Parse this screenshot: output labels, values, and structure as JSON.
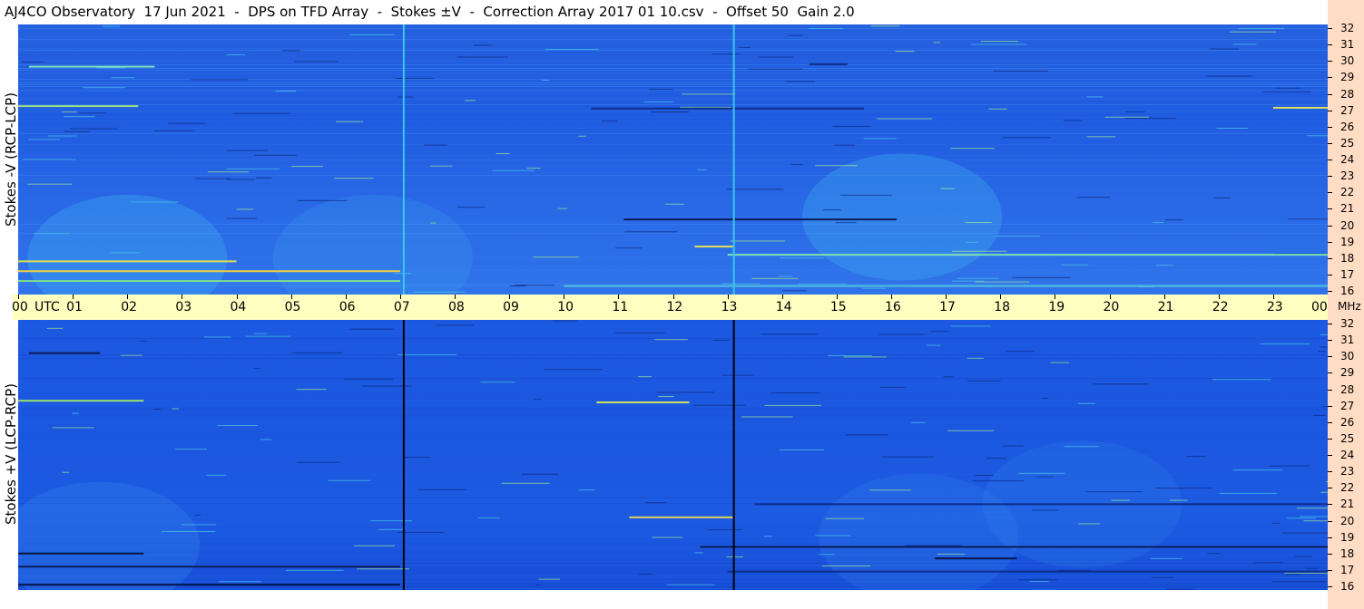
{
  "title": "AJ4CO Observatory  17 Jun 2021  -  DPS on TFD Array  -  Stokes ±V  -  Correction Array 2017 01 10.csv  -  Offset 50  Gain 2.0",
  "colors": {
    "time_axis_bg": "#ffffc0",
    "freq_axis_bg": "#ffdcc4",
    "background_blue": "#1f5be0"
  },
  "chart_data": [
    {
      "type": "heatmap",
      "name": "top-panel",
      "ylabel": "Stokes -V (RCP-LCP)",
      "x_ticks": [
        "00",
        "01",
        "02",
        "03",
        "04",
        "05",
        "06",
        "07",
        "08",
        "09",
        "10",
        "11",
        "12",
        "13",
        "14",
        "15",
        "16",
        "17",
        "18",
        "19",
        "20",
        "21",
        "22",
        "23",
        "00"
      ],
      "x_unit": "UTC",
      "xlim": [
        0,
        24
      ],
      "y_ticks": [
        "32",
        "31",
        "30",
        "29",
        "28",
        "27",
        "26",
        "25",
        "24",
        "23",
        "22",
        "21",
        "20",
        "19",
        "18",
        "17",
        "16"
      ],
      "y_unit": "MHz",
      "ylim": [
        16,
        32
      ],
      "vertical_lines_utc": [
        7.05,
        13.1
      ],
      "vertical_line_color": "#38c8e8",
      "bands": [
        {
          "mhz": 29.65,
          "t0": 0.2,
          "t1": 2.5,
          "color": "#7fe0c0"
        },
        {
          "mhz": 27.25,
          "t0": 0.0,
          "t1": 2.2,
          "color": "#9ae080"
        },
        {
          "mhz": 27.1,
          "t0": 10.5,
          "t1": 15.5,
          "color": "#0d2d8a"
        },
        {
          "mhz": 27.15,
          "t0": 23.0,
          "t1": 24.0,
          "color": "#e0e060"
        },
        {
          "mhz": 20.35,
          "t0": 11.1,
          "t1": 16.1,
          "color": "#0a1c5a"
        },
        {
          "mhz": 18.7,
          "t0": 12.4,
          "t1": 13.1,
          "color": "#e0e060"
        },
        {
          "mhz": 18.2,
          "t0": 13.0,
          "t1": 24.0,
          "color": "#7fe0b0"
        },
        {
          "mhz": 17.8,
          "t0": 0.0,
          "t1": 4.0,
          "color": "#e0e050"
        },
        {
          "mhz": 17.2,
          "t0": 0.0,
          "t1": 7.0,
          "color": "#f0d040"
        },
        {
          "mhz": 16.6,
          "t0": 0.0,
          "t1": 7.0,
          "color": "#80e090"
        },
        {
          "mhz": 16.3,
          "t0": 10.0,
          "t1": 24.0,
          "color": "#50c0e0"
        },
        {
          "mhz": 29.8,
          "t0": 14.5,
          "t1": 15.2,
          "color": "#0d2d8a"
        }
      ]
    },
    {
      "type": "heatmap",
      "name": "bottom-panel",
      "ylabel": "Stokes +V (LCP-RCP)",
      "x_ticks": [
        "00",
        "01",
        "02",
        "03",
        "04",
        "05",
        "06",
        "07",
        "08",
        "09",
        "10",
        "11",
        "12",
        "13",
        "14",
        "15",
        "16",
        "17",
        "18",
        "19",
        "20",
        "21",
        "22",
        "23",
        "00"
      ],
      "x_unit": "UTC",
      "xlim": [
        0,
        24
      ],
      "y_ticks": [
        "32",
        "31",
        "30",
        "29",
        "28",
        "27",
        "26",
        "25",
        "24",
        "23",
        "22",
        "21",
        "20",
        "19",
        "18",
        "17",
        "16"
      ],
      "y_unit": "MHz",
      "ylim": [
        16,
        32
      ],
      "vertical_lines_utc": [
        7.05,
        13.1
      ],
      "vertical_line_color": "#000000",
      "bands": [
        {
          "mhz": 30.2,
          "t0": 0.2,
          "t1": 1.5,
          "color": "#0a1c5a"
        },
        {
          "mhz": 27.3,
          "t0": 0.0,
          "t1": 2.3,
          "color": "#9ae070"
        },
        {
          "mhz": 27.2,
          "t0": 10.6,
          "t1": 12.3,
          "color": "#d0e060"
        },
        {
          "mhz": 20.2,
          "t0": 11.2,
          "t1": 13.1,
          "color": "#e0d060"
        },
        {
          "mhz": 18.4,
          "t0": 12.5,
          "t1": 24.0,
          "color": "#0a1c5a"
        },
        {
          "mhz": 18.0,
          "t0": 0.0,
          "t1": 2.3,
          "color": "#071445"
        },
        {
          "mhz": 17.7,
          "t0": 16.8,
          "t1": 18.3,
          "color": "#071445"
        },
        {
          "mhz": 17.2,
          "t0": 0.0,
          "t1": 7.0,
          "color": "#0a1c5a"
        },
        {
          "mhz": 16.9,
          "t0": 13.0,
          "t1": 24.0,
          "color": "#0d2d8a"
        },
        {
          "mhz": 16.1,
          "t0": 0.0,
          "t1": 7.0,
          "color": "#071445"
        },
        {
          "mhz": 21.0,
          "t0": 13.5,
          "t1": 24.0,
          "color": "#0d2d8a"
        }
      ]
    }
  ],
  "axis": {
    "utc_label": "UTC",
    "mhz_label": "MHz"
  }
}
